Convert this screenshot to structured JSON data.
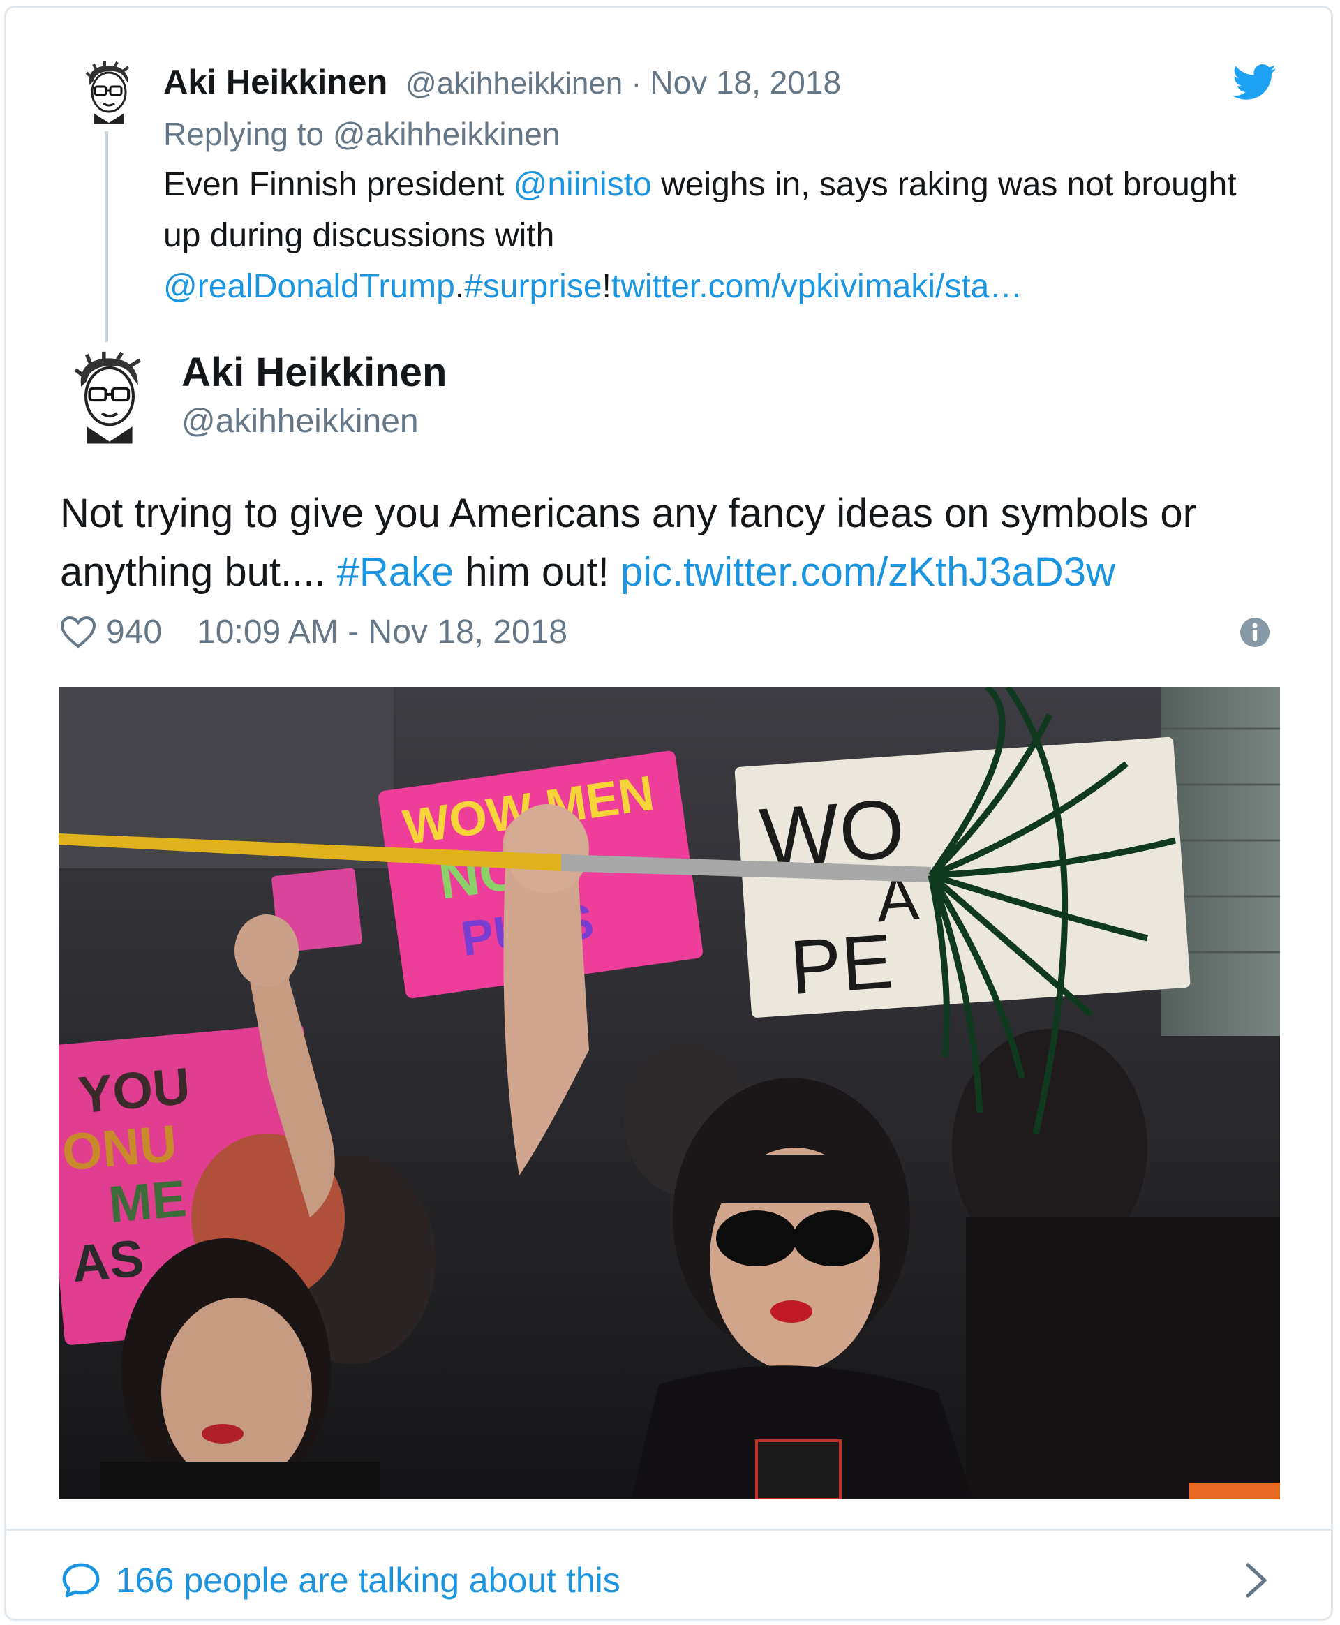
{
  "parent_tweet": {
    "name": "Aki Heikkinen",
    "handle": "@akihheikkinen",
    "separator": " · ",
    "date": "Nov 18, 2018",
    "replying_prefix": "Replying to ",
    "replying_handle": "@akihheikkinen",
    "text_part1": "Even Finnish president ",
    "mention_niinisto": "@niinisto",
    "text_part2": " weighs in, says raking was not brought up during discussions with ",
    "mention_trump": "@realDonaldTrump",
    "text_part3": ".",
    "hashtag_surprise": "#surprise",
    "text_part4": "!",
    "link": "twitter.com/vpkivimaki/sta…"
  },
  "main_tweet": {
    "name": "Aki Heikkinen",
    "handle": "@akihheikkinen",
    "text_part1": "Not trying to give you Americans any fancy ideas on symbols or anything but.... ",
    "hashtag_rake": "#Rake",
    "text_part2": " him out! ",
    "pic_link": "pic.twitter.com/zKthJ3aD3w",
    "likes": "940",
    "timestamp": "10:09 AM - Nov 18, 2018"
  },
  "photo_signs": {
    "sign_center_1": "WOW MEN",
    "sign_center_2": "NOT",
    "sign_center_3": "PUSS",
    "sign_white_1": "WO",
    "sign_white_2": "A",
    "sign_white_3": "PE",
    "sign_left_1": "YOU",
    "sign_left_2": "ONU",
    "sign_left_3": "ME",
    "sign_left_4": "AS"
  },
  "footer": {
    "talking_text": "166 people are talking about this"
  },
  "icons": {
    "bird": "twitter-bird-icon",
    "heart": "heart-icon",
    "info": "info-icon",
    "bubble": "speech-bubble-icon",
    "chevron": "chevron-right-icon"
  },
  "colors": {
    "link": "#1b95e0",
    "muted": "#657786",
    "text": "#14171a",
    "border": "#e1e8ed"
  }
}
